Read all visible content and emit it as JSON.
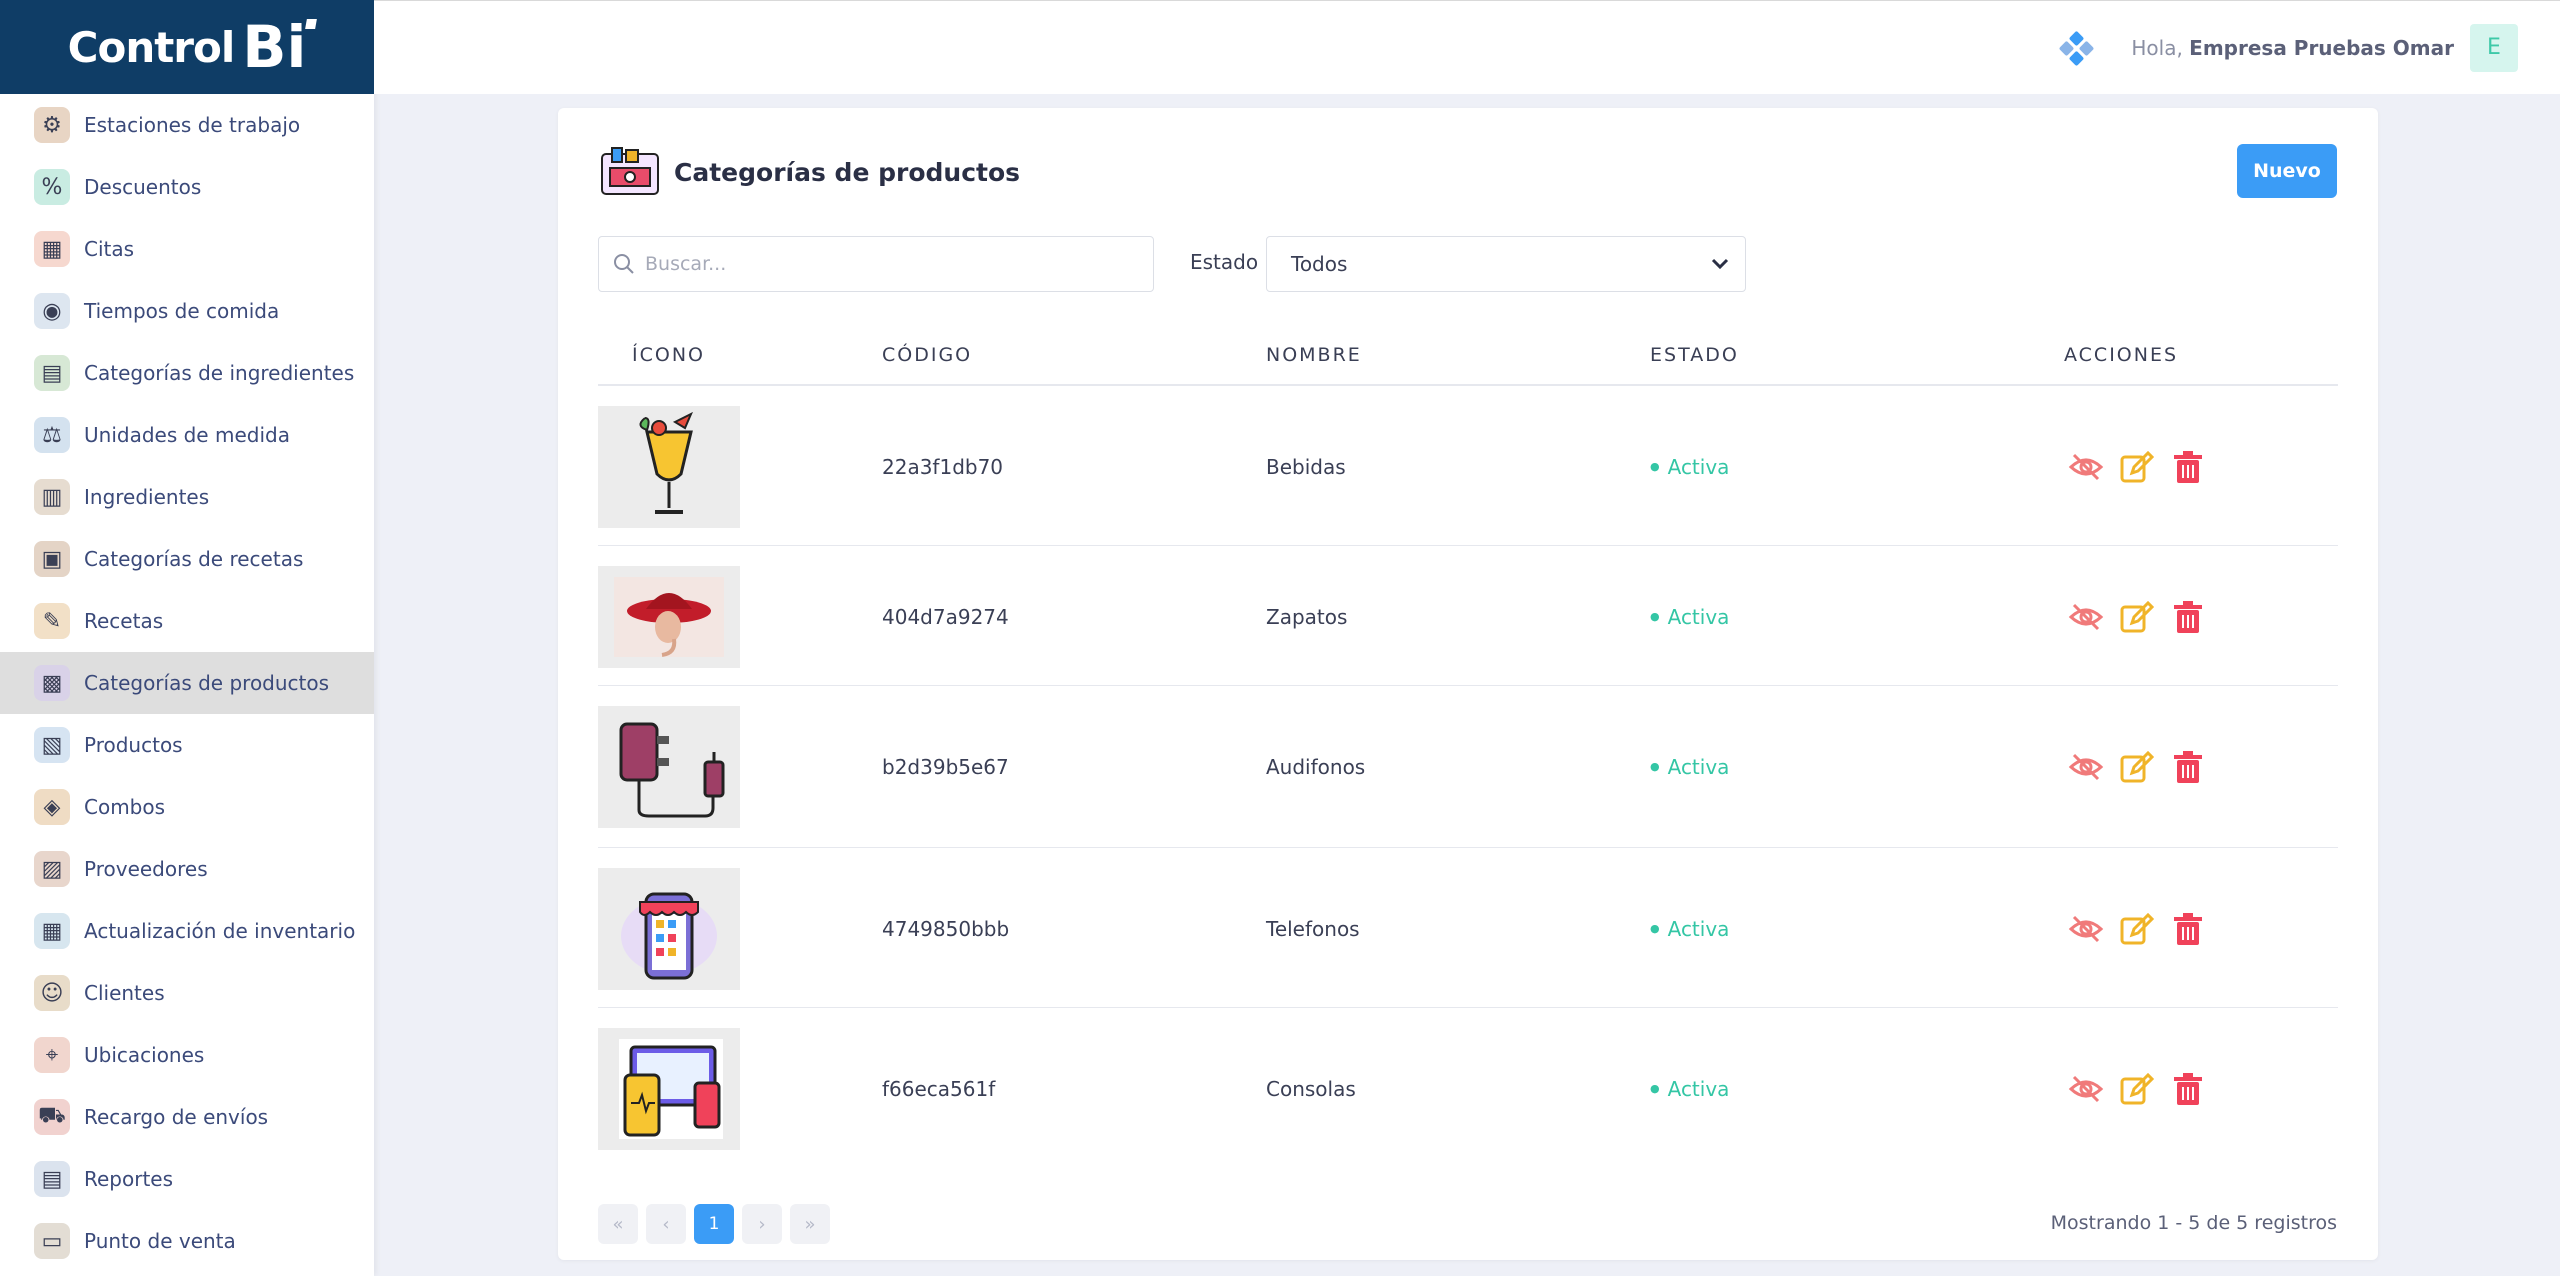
{
  "brand": {
    "logo_text": "Control",
    "logo_bi": "Bi"
  },
  "sidebar": {
    "items": [
      {
        "label": "Estaciones de trabajo",
        "icon": "workstation-icon",
        "color": "#e8d5c4"
      },
      {
        "label": "Descuentos",
        "icon": "discount-icon",
        "color": "#c9ece2"
      },
      {
        "label": "Citas",
        "icon": "calendar-icon",
        "color": "#f6d8cf"
      },
      {
        "label": "Tiempos de comida",
        "icon": "plate-icon",
        "color": "#dde6f0"
      },
      {
        "label": "Categorías de ingredientes",
        "icon": "ingredients-category-icon",
        "color": "#d7e8d5"
      },
      {
        "label": "Unidades de medida",
        "icon": "measure-icon",
        "color": "#d4e2ef"
      },
      {
        "label": "Ingredientes",
        "icon": "ingredients-icon",
        "color": "#e6dcd0"
      },
      {
        "label": "Categorías de recetas",
        "icon": "recipe-book-icon",
        "color": "#e4d4c6"
      },
      {
        "label": "Recetas",
        "icon": "recipe-icon",
        "color": "#f2e0c7"
      },
      {
        "label": "Categorías de productos",
        "icon": "product-category-icon",
        "color": "#d9d2e8"
      },
      {
        "label": "Productos",
        "icon": "products-icon",
        "color": "#d6e4f2"
      },
      {
        "label": "Combos",
        "icon": "combo-icon",
        "color": "#efdcc4"
      },
      {
        "label": "Proveedores",
        "icon": "supplier-icon",
        "color": "#e8d6cc"
      },
      {
        "label": "Actualización de inventario",
        "icon": "inventory-icon",
        "color": "#d7e6ef"
      },
      {
        "label": "Clientes",
        "icon": "clients-icon",
        "color": "#e8dcc9"
      },
      {
        "label": "Ubicaciones",
        "icon": "location-icon",
        "color": "#f1d6ce"
      },
      {
        "label": "Recargo de envíos",
        "icon": "delivery-icon",
        "color": "#f1d2cf"
      },
      {
        "label": "Reportes",
        "icon": "reports-icon",
        "color": "#dbe3ee"
      },
      {
        "label": "Punto de venta",
        "icon": "pos-icon",
        "color": "#e3ddd4"
      }
    ]
  },
  "topbar": {
    "greeting": "Hola,",
    "user": "Empresa Pruebas Omar",
    "avatar_letter": "E"
  },
  "page": {
    "title": "Categorías de productos",
    "new_button": "Nuevo",
    "search_placeholder": "Buscar...",
    "estado_label": "Estado",
    "estado_value": "Todos"
  },
  "table": {
    "headers": {
      "icon": "ÍCONO",
      "code": "CÓDIGO",
      "name": "NOMBRE",
      "status": "ESTADO",
      "actions": "ACCIONES"
    },
    "rows": [
      {
        "code": "22a3f1db70",
        "name": "Bebidas",
        "status": "Activa",
        "image": "cocktail-icon"
      },
      {
        "code": "404d7a9274",
        "name": "Zapatos",
        "status": "Activa",
        "image": "woman-hat-photo"
      },
      {
        "code": "b2d39b5e67",
        "name": "Audifonos",
        "status": "Activa",
        "image": "charger-icon"
      },
      {
        "code": "4749850bbb",
        "name": "Telefonos",
        "status": "Activa",
        "image": "phone-store-icon"
      },
      {
        "code": "f66eca561f",
        "name": "Consolas",
        "status": "Activa",
        "image": "devices-icon"
      }
    ]
  },
  "pagination": {
    "current": "1",
    "summary": "Mostrando 1 - 5 de 5 registros"
  },
  "colors": {
    "primary": "#3b9cf6",
    "active": "#34c6a5",
    "navy": "#0f3d66",
    "edit": "#f0b429",
    "delete": "#f0425a",
    "hide": "#f07a7a"
  }
}
